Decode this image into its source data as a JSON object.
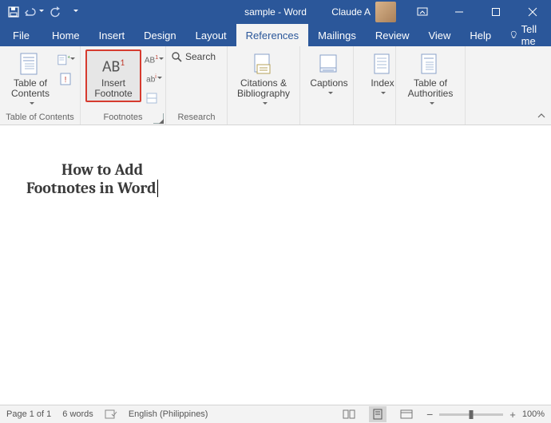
{
  "titlebar": {
    "title": "sample  -  Word",
    "user": "Claude A"
  },
  "tabs": {
    "file": "File",
    "home": "Home",
    "insert": "Insert",
    "design": "Design",
    "layout": "Layout",
    "references": "References",
    "mailings": "Mailings",
    "review": "Review",
    "view": "View",
    "help": "Help",
    "tellme": "Tell me"
  },
  "ribbon": {
    "toc": {
      "btn": "Table of\nContents",
      "group": "Table of Contents"
    },
    "footnotes": {
      "insert": "Insert\nFootnote",
      "group": "Footnotes"
    },
    "research": {
      "search": "Search",
      "group": "Research"
    },
    "citations": {
      "btn": "Citations &\nBibliography",
      "group": ""
    },
    "captions": {
      "btn": "Captions",
      "group": ""
    },
    "index": {
      "btn": "Index",
      "group": ""
    },
    "toa": {
      "btn": "Table of\nAuthorities",
      "group": ""
    }
  },
  "document": {
    "line1": "How to Add",
    "line2": "Footnotes in Word"
  },
  "status": {
    "page": "Page 1 of 1",
    "words": "6 words",
    "lang": "English (Philippines)",
    "zoom": "100%"
  }
}
